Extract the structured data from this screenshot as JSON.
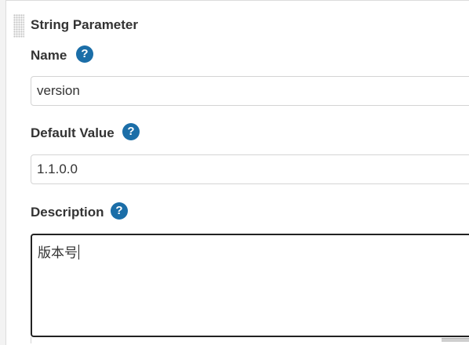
{
  "parameter": {
    "type_title": "String Parameter",
    "name": {
      "label": "Name",
      "help": "?",
      "value": "version"
    },
    "default_value": {
      "label": "Default Value",
      "help": "?",
      "value": "1.1.0.0"
    },
    "description": {
      "label": "Description",
      "help": "?",
      "value": "版本号"
    }
  },
  "colors": {
    "help_icon": "#1b6ea8",
    "label_text": "#333333",
    "focused_border": "#222222"
  }
}
